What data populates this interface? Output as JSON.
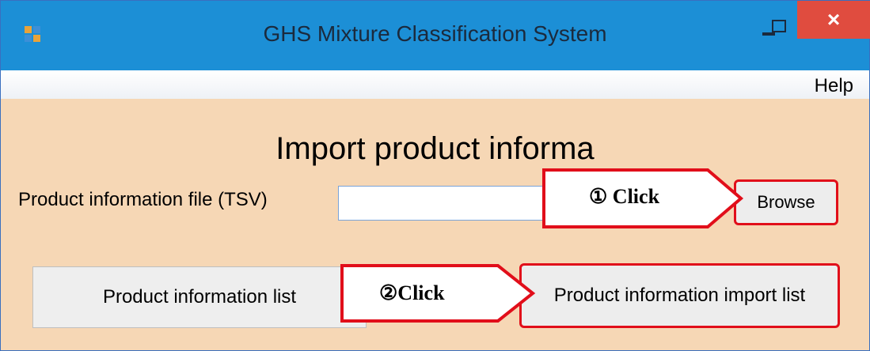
{
  "window": {
    "title": "GHS Mixture Classification System",
    "close_glyph": "×"
  },
  "menu": {
    "help": "Help"
  },
  "main": {
    "heading": "Import  product informa",
    "file_label": "Product information file (TSV)",
    "file_value": "",
    "browse_label": "Browse",
    "list_button": "Product information list",
    "import_button": "Product information import list"
  },
  "annotations": {
    "step1": "①  Click",
    "step2": "②Click",
    "highlight_color": "#e10e1a"
  },
  "colors": {
    "titlebar": "#1c8fd6",
    "client_background": "#f6d7b5",
    "close_button": "#e04c3f"
  },
  "icons": {
    "app": "app-icon",
    "minimize": "minimize-icon",
    "maximize": "maximize-icon",
    "close": "close-icon"
  }
}
